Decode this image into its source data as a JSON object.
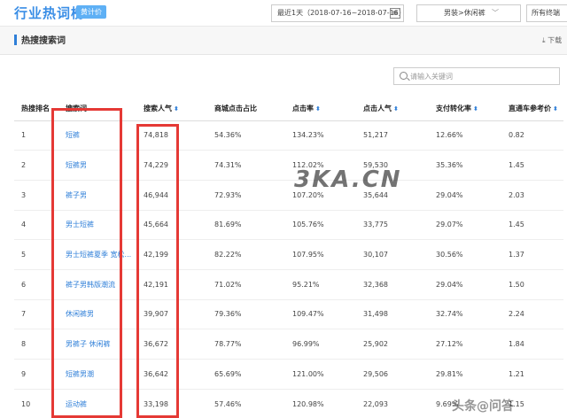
{
  "header": {
    "title": "行业热词榜",
    "tag": "黄计价",
    "date_range": "最近1天（2018-07-16~2018-07-16）",
    "category": "男装>休闲裤",
    "terminal": "所有终端"
  },
  "section": {
    "title": "热搜搜索词",
    "download": "下载"
  },
  "search": {
    "placeholder": "请输入关键词"
  },
  "table": {
    "columns": [
      "热搜排名",
      "搜索词",
      "搜索人气",
      "商城点击占比",
      "点击率",
      "点击人气",
      "支付转化率",
      "直通车参考价"
    ],
    "rows": [
      [
        "1",
        "短裤",
        "74,818",
        "54.36%",
        "134.23%",
        "51,217",
        "12.66%",
        "0.82"
      ],
      [
        "2",
        "短裤男",
        "74,229",
        "74.31%",
        "112.02%",
        "59,530",
        "35.36%",
        "1.45"
      ],
      [
        "3",
        "裤子男",
        "46,944",
        "72.93%",
        "107.20%",
        "35,644",
        "29.04%",
        "2.03"
      ],
      [
        "4",
        "男士短裤",
        "45,664",
        "81.69%",
        "105.76%",
        "33,775",
        "29.07%",
        "1.45"
      ],
      [
        "5",
        "男士短裤夏季 宽松...",
        "42,199",
        "82.22%",
        "107.95%",
        "30,107",
        "30.56%",
        "1.37"
      ],
      [
        "6",
        "裤子男韩版潮流",
        "42,191",
        "71.02%",
        "95.21%",
        "32,368",
        "29.04%",
        "1.50"
      ],
      [
        "7",
        "休闲裤男",
        "39,907",
        "79.36%",
        "109.47%",
        "31,498",
        "32.74%",
        "2.24"
      ],
      [
        "8",
        "男裤子 休闲裤",
        "36,672",
        "78.77%",
        "96.99%",
        "25,902",
        "27.12%",
        "1.84"
      ],
      [
        "9",
        "短裤男潮",
        "36,642",
        "65.69%",
        "121.00%",
        "29,506",
        "29.81%",
        "1.21"
      ],
      [
        "10",
        "运动裤",
        "33,198",
        "57.46%",
        "120.98%",
        "22,093",
        "9.69%",
        "1.15"
      ]
    ]
  },
  "watermark": {
    "center": "3KA.CN",
    "corner": "头条@问答"
  },
  "colors": {
    "accent": "#2f7fd8",
    "highlight": "#e53935"
  }
}
